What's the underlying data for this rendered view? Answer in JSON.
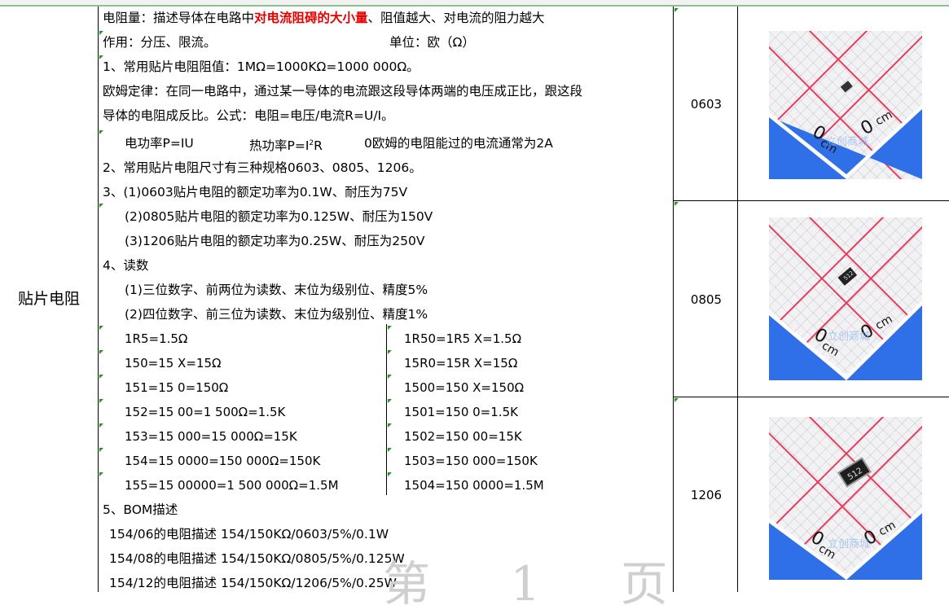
{
  "row_label": "贴片电阻",
  "lines": {
    "l1_pre": "电阻量：描述导体在电路中",
    "l1_red": "对电流阻碍的大小量",
    "l1_post": "、阻值越大、对电流的阻力越大",
    "l2a": "作用：分压、限流。",
    "l2b": "单位：欧（Ω）",
    "l3": "1、常用贴片电阻阻值：1MΩ=1000KΩ=1000 000Ω。",
    "l4": "欧姆定律：在同一电路中，通过某一导体的电流跟这段导体两端的电压成正比，跟这段",
    "l5": "导体的电阻成反比。公式：电阻=电压/电流R=U/I。",
    "l6a": "电功率P=IU",
    "l6b_pre": "热功率P=I",
    "l6b_sup": "2",
    "l6b_post": "R",
    "l6c": "0欧姆的电阻能过的电流通常为2A",
    "l7": "2、常用贴片电阻尺寸有三种规格0603、0805、1206。",
    "l8": "3、(1)0603贴片电阻的额定功率为0.1W、耐压为75V",
    "l9": "(2)0805贴片电阻的额定功率为0.125W、耐压为150V",
    "l10": "(3)1206贴片电阻的额定功率为0.25W、耐压为250V",
    "l11": "4、读数",
    "l12": "(1)三位数字、前两位为读数、末位为级别位、精度5%",
    "l13": "(2)四位数字、前三位为读数、末位为级别位、精度1%",
    "l_bom": "5、BOM描述",
    "bom1": "154/06的电阻描述 154/150KΩ/0603/5%/0.1W",
    "bom2": "154/08的电阻描述 154/150KΩ/0805/5%/0.125W",
    "bom3": "154/12的电阻描述 154/150KΩ/1206/5%/0.25W"
  },
  "readings_left": [
    "1R5=1.5Ω",
    "150=15 X=15Ω",
    "151=15 0=150Ω",
    "152=15 00=1 500Ω=1.5K",
    "153=15 000=15 000Ω=15K",
    "154=15 0000=150 000Ω=150K",
    "155=15 00000=1 500 000Ω=1.5M"
  ],
  "readings_right": [
    "1R50=1R5 X=1.5Ω",
    "15R0=15R X=15Ω",
    "1500=150 X=150Ω",
    "1501=150 0=1.5K",
    "1502=150 00=15K",
    "1503=150 000=150K",
    "1504=150 0000=1.5M"
  ],
  "sizes": [
    "0603",
    "0805",
    "1206"
  ],
  "photo": {
    "cm": "cm",
    "zero": "0",
    "chip_code": "512",
    "logo": "立创商城"
  },
  "watermark": "第 1 页",
  "colors": {
    "grid_red": "#e83a5a",
    "blue": "#2f6fe8",
    "green_mark": "#1a9c1a"
  }
}
